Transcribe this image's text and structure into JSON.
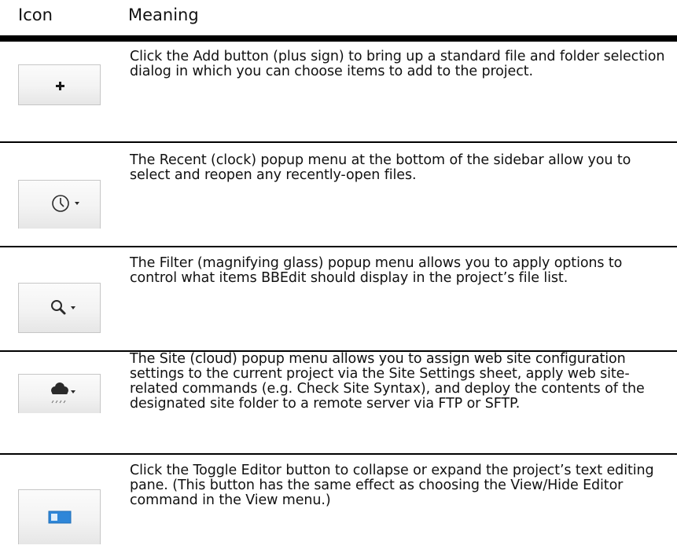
{
  "header": {
    "icon_label": "Icon",
    "meaning_label": "Meaning"
  },
  "rows": [
    {
      "icon": "plus-icon",
      "text": "Click the Add button (plus sign) to bring up a standard file and folder selection dialog in which you can choose items to add to the project."
    },
    {
      "icon": "clock-icon",
      "text": "The Recent (clock) popup menu at the bottom of the sidebar allow you to select and reopen any recently-open files."
    },
    {
      "icon": "magnifying-glass-icon",
      "text": "The Filter (magnifying glass) popup menu allows you to apply options to control what items BBEdit should display in the project’s file list."
    },
    {
      "icon": "cloud-icon",
      "text": "The Site (cloud) popup menu allows you to assign web site configuration settings to the current project via the Site Settings sheet, apply web site-related commands (e.g. Check Site Syntax), and deploy the contents of the designated site folder to a remote server via FTP or SFTP."
    },
    {
      "icon": "toggle-editor-icon",
      "text": "Click the Toggle Editor button to collapse or expand the project’s text editing pane. (This button has the same effect as choosing the View/Hide Editor command in the View menu.)"
    }
  ]
}
